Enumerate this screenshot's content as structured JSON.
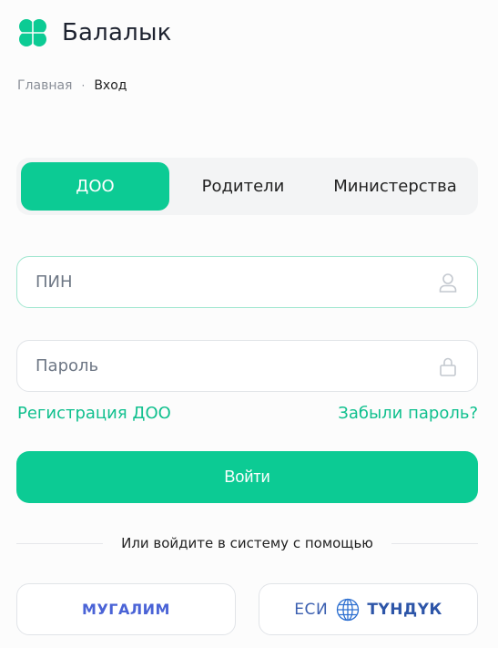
{
  "app": {
    "brand_name": "Балалык"
  },
  "breadcrumb": {
    "home": "Главная",
    "separator": "·",
    "current": "Вход"
  },
  "tabs": [
    {
      "label": "ДОО",
      "active": true
    },
    {
      "label": "Родители",
      "active": false
    },
    {
      "label": "Министерства",
      "active": false
    }
  ],
  "form": {
    "pin": {
      "placeholder": "ПИН",
      "value": "",
      "icon": "user-icon"
    },
    "password": {
      "placeholder": "Пароль",
      "value": "",
      "icon": "lock-icon"
    },
    "register_link": "Регистрация ДОО",
    "forgot_link": "Забыли пароль?",
    "submit_label": "Войти"
  },
  "alt_login": {
    "divider_text": "Или войдите в систему с помощью",
    "mugalim_label": "МУГАЛИМ",
    "esi_prefix": "ЕСИ",
    "esi_name": "ТҮНДҮК"
  },
  "colors": {
    "accent": "#0ccb94",
    "link": "#10c08e",
    "mugalim": "#4a63d6",
    "tunduk": "#2d55a8"
  }
}
